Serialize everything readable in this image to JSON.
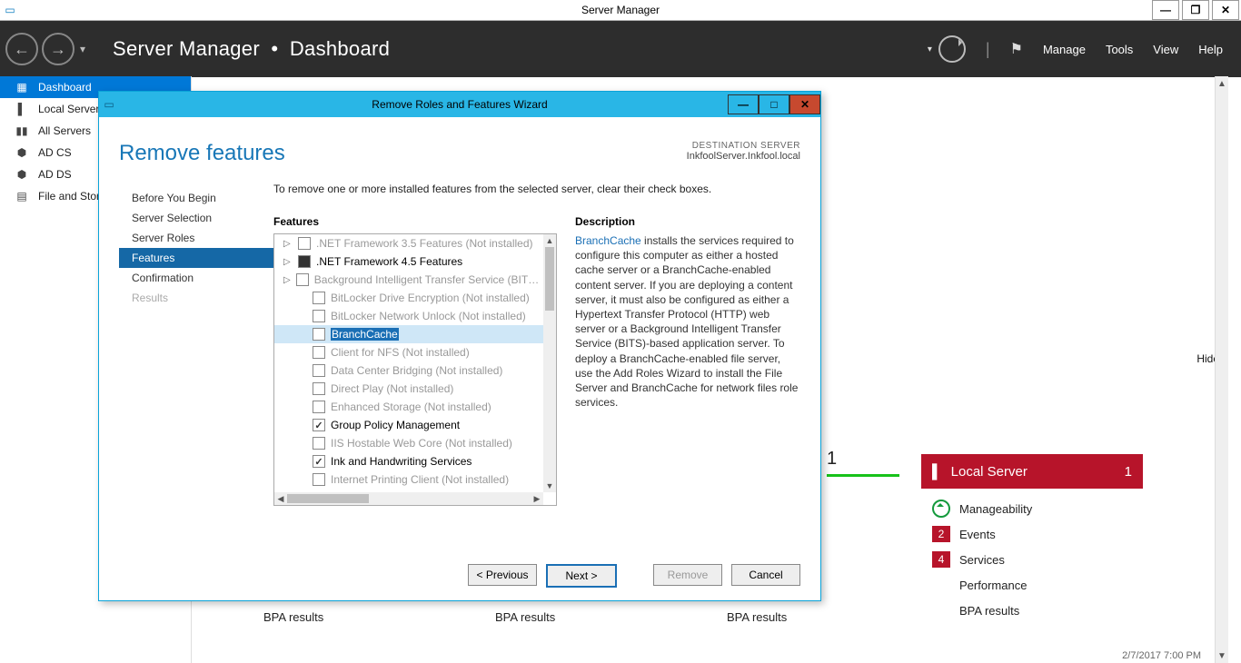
{
  "titlebar": {
    "app": "Server Manager"
  },
  "toolbar": {
    "breadcrumb_1": "Server Manager",
    "breadcrumb_2": "Dashboard",
    "menu": {
      "manage": "Manage",
      "tools": "Tools",
      "view": "View",
      "help": "Help"
    }
  },
  "nav": {
    "items": [
      {
        "label": "Dashboard",
        "icon": "dashboard"
      },
      {
        "label": "Local Server",
        "icon": "server"
      },
      {
        "label": "All Servers",
        "icon": "servers"
      },
      {
        "label": "AD CS",
        "icon": "role"
      },
      {
        "label": "AD DS",
        "icon": "role"
      },
      {
        "label": "File and Storage Services",
        "icon": "storage"
      }
    ]
  },
  "content": {
    "hide": "Hide",
    "bpa": "BPA results",
    "timestamp": "2/7/2017 7:00 PM",
    "visible_number": "1",
    "tile": {
      "title": "Local Server",
      "count": "1",
      "rows": [
        {
          "kind": "ok",
          "label": "Manageability"
        },
        {
          "kind": "bad",
          "badge": "2",
          "label": "Events"
        },
        {
          "kind": "bad",
          "badge": "4",
          "label": "Services"
        },
        {
          "kind": "plain",
          "label": "Performance"
        },
        {
          "kind": "plain",
          "label": "BPA results"
        }
      ]
    }
  },
  "wizard": {
    "title_bar": "Remove Roles and Features Wizard",
    "heading": "Remove features",
    "dest_label": "DESTINATION SERVER",
    "dest_server": "InkfoolServer.Inkfool.local",
    "steps": [
      {
        "label": "Before You Begin",
        "state": ""
      },
      {
        "label": "Server Selection",
        "state": ""
      },
      {
        "label": "Server Roles",
        "state": ""
      },
      {
        "label": "Features",
        "state": "active"
      },
      {
        "label": "Confirmation",
        "state": ""
      },
      {
        "label": "Results",
        "state": "disabled"
      }
    ],
    "instruction": "To remove one or more installed features from the selected server, clear their check boxes.",
    "features_header": "Features",
    "description_header": "Description",
    "features": [
      {
        "exp": "▷",
        "chk": "empty",
        "label": ".NET Framework 3.5 Features (Not installed)",
        "state": "disabled",
        "indent": 0
      },
      {
        "exp": "▷",
        "chk": "filled",
        "label": ".NET Framework 4.5 Features",
        "state": "",
        "indent": 0
      },
      {
        "exp": "▷",
        "chk": "empty",
        "label": "Background Intelligent Transfer Service (BITS) (Not installed)",
        "state": "disabled",
        "indent": 0
      },
      {
        "exp": "",
        "chk": "empty",
        "label": "BitLocker Drive Encryption (Not installed)",
        "state": "disabled",
        "indent": 1
      },
      {
        "exp": "",
        "chk": "empty",
        "label": "BitLocker Network Unlock (Not installed)",
        "state": "disabled",
        "indent": 1
      },
      {
        "exp": "",
        "chk": "empty",
        "label": "BranchCache",
        "state": "sel",
        "indent": 1,
        "highlight": true
      },
      {
        "exp": "",
        "chk": "empty",
        "label": "Client for NFS (Not installed)",
        "state": "disabled",
        "indent": 1
      },
      {
        "exp": "",
        "chk": "empty",
        "label": "Data Center Bridging (Not installed)",
        "state": "disabled",
        "indent": 1
      },
      {
        "exp": "",
        "chk": "empty",
        "label": "Direct Play (Not installed)",
        "state": "disabled",
        "indent": 1
      },
      {
        "exp": "",
        "chk": "empty",
        "label": "Enhanced Storage (Not installed)",
        "state": "disabled",
        "indent": 1
      },
      {
        "exp": "",
        "chk": "checked",
        "label": "Group Policy Management",
        "state": "",
        "indent": 1
      },
      {
        "exp": "",
        "chk": "empty",
        "label": "IIS Hostable Web Core (Not installed)",
        "state": "disabled",
        "indent": 1
      },
      {
        "exp": "",
        "chk": "checked",
        "label": "Ink and Handwriting Services",
        "state": "",
        "indent": 1
      },
      {
        "exp": "",
        "chk": "empty",
        "label": "Internet Printing Client (Not installed)",
        "state": "disabled",
        "indent": 1
      }
    ],
    "description_lead": "BranchCache",
    "description": " installs the services required to configure this computer as either a hosted cache server or a BranchCache-enabled content server. If you are deploying a content server, it must also be configured as either a Hypertext Transfer Protocol (HTTP) web server or a Background Intelligent Transfer Service (BITS)-based application server. To deploy a BranchCache-enabled file server, use the Add Roles Wizard to install the File Server and BranchCache for network files role services.",
    "buttons": {
      "prev": "< Previous",
      "next": "Next >",
      "remove": "Remove",
      "cancel": "Cancel"
    }
  }
}
